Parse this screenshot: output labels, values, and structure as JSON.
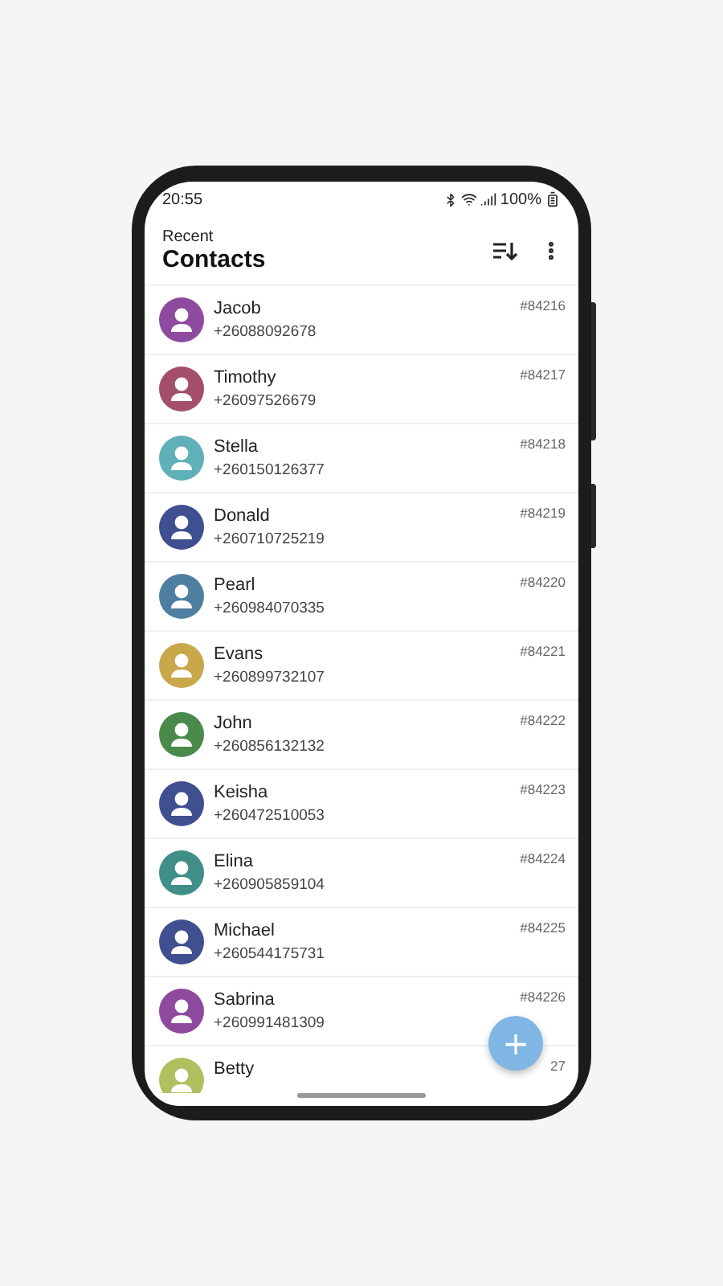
{
  "status_bar": {
    "time": "20:55",
    "battery": "100%"
  },
  "header": {
    "subtitle": "Recent",
    "title": "Contacts"
  },
  "contacts": [
    {
      "name": "Jacob",
      "phone": "+26088092678",
      "id": "#84216",
      "color": "#8e4a9e"
    },
    {
      "name": "Timothy",
      "phone": "+26097526679",
      "id": "#84217",
      "color": "#a44f6a"
    },
    {
      "name": "Stella",
      "phone": "+260150126377",
      "id": "#84218",
      "color": "#5fb0b8"
    },
    {
      "name": "Donald",
      "phone": "+260710725219",
      "id": "#84219",
      "color": "#3f4f90"
    },
    {
      "name": "Pearl",
      "phone": "+260984070335",
      "id": "#84220",
      "color": "#4f7fa0"
    },
    {
      "name": "Evans",
      "phone": "+260899732107",
      "id": "#84221",
      "color": "#c8a84a"
    },
    {
      "name": "John",
      "phone": "+260856132132",
      "id": "#84222",
      "color": "#4a8a4a"
    },
    {
      "name": "Keisha",
      "phone": "+260472510053",
      "id": "#84223",
      "color": "#3f4f90"
    },
    {
      "name": "Elina",
      "phone": "+260905859104",
      "id": "#84224",
      "color": "#3f8f88"
    },
    {
      "name": "Michael",
      "phone": "+260544175731",
      "id": "#84225",
      "color": "#3f4f90"
    },
    {
      "name": "Sabrina",
      "phone": "+260991481309",
      "id": "#84226",
      "color": "#8e4a9e"
    },
    {
      "name": "Betty",
      "id": "27",
      "color": "#b0c060"
    }
  ],
  "fab": {
    "label": "+"
  }
}
